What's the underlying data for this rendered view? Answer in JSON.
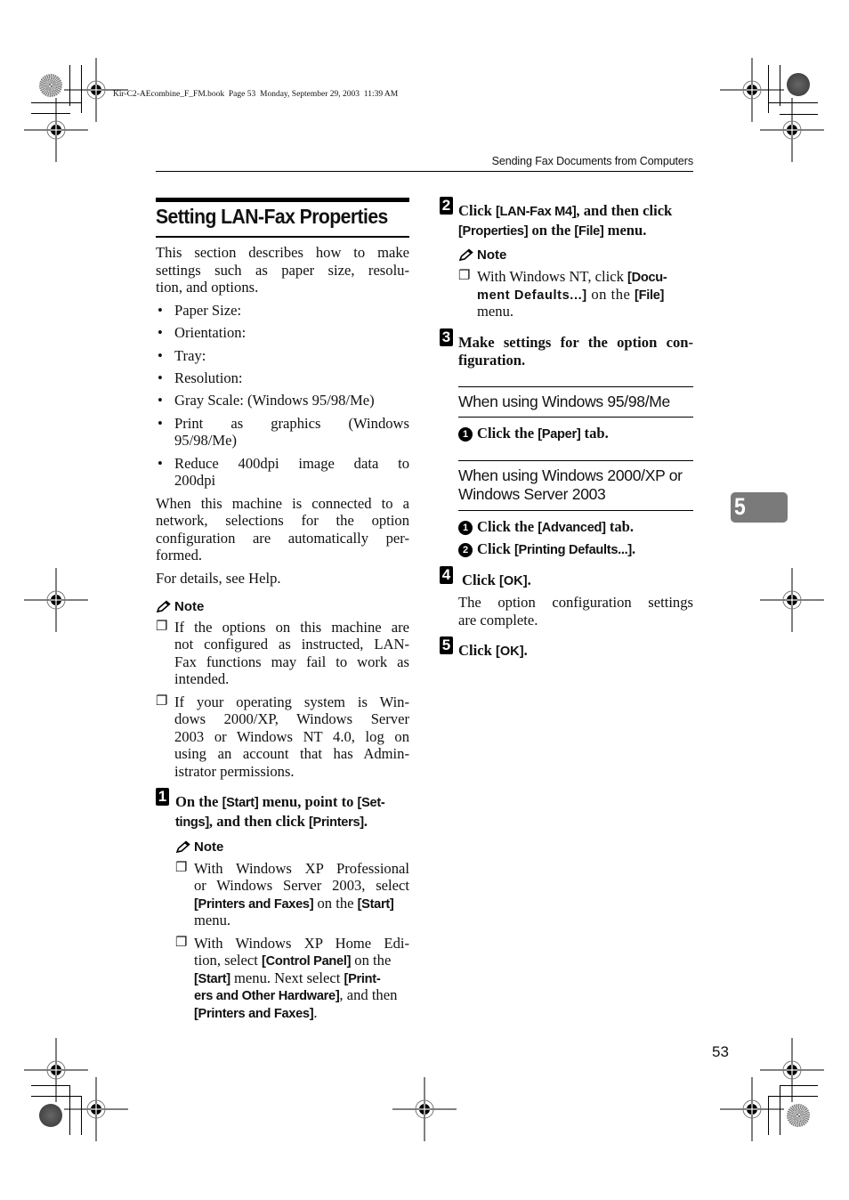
{
  "slug_line": "Kir-C2-AEcombine_F_FM.book  Page 53  Monday, September 29, 2003  11:39 AM",
  "running_head": "Sending Fax Documents from Computers",
  "chapter_tab": "5",
  "page_number": "53",
  "section": {
    "title": "Setting LAN-Fax Properties",
    "intro": "This section describes how to make settings such as paper size, resolution, and options.",
    "intro_lines": [
      "This section describes how to make",
      "settings such as paper size, resolu-",
      "tion, and options."
    ],
    "bullets": [
      {
        "lines": [
          "Paper Size:"
        ]
      },
      {
        "lines": [
          "Orientation:"
        ]
      },
      {
        "lines": [
          "Tray:"
        ]
      },
      {
        "lines": [
          "Resolution:"
        ]
      },
      {
        "lines": [
          "Gray Scale: (Windows 95/98/Me)"
        ]
      },
      {
        "lines": [
          "Print as graphics (Windows",
          "95/98/Me)"
        ]
      },
      {
        "lines": [
          "Reduce 400dpi image data to",
          "200dpi"
        ]
      }
    ],
    "network_para_lines": [
      "When this machine is connected to a",
      "network, selections for the option",
      "configuration are automatically per-",
      "formed."
    ],
    "help_para": "For details, see Help.",
    "note": {
      "label": "Note",
      "items": [
        {
          "lines": [
            "If the options on this machine are",
            "not configured as instructed, LAN-",
            "Fax functions may fail to work as",
            "intended."
          ]
        },
        {
          "lines": [
            "If your operating system is Win-",
            "dows 2000/XP, Windows Server",
            "2003 or Windows NT 4.0, log on",
            "using an account that has Admin-",
            "istrator permissions."
          ]
        }
      ]
    }
  },
  "steps": [
    {
      "number": "1",
      "line1_a": "On the ",
      "line1_ui1": "[Start]",
      "line1_b": " menu, point to ",
      "line1_ui2": "[Set-",
      "line2_ui": "tings]",
      "line2_b": ", and then click ",
      "line2_ui2": "[Printers]",
      "line2_c": ".",
      "note": {
        "label": "Note",
        "item1": {
          "l1": "With Windows XP Professional",
          "l2": "or Windows Server 2003, select",
          "l3_ui1": "[Printers and Faxes]",
          "l3_b": " on the ",
          "l3_ui2": "[Start]",
          "l4": "menu."
        },
        "item2": {
          "l1": "With Windows XP Home Edi-",
          "l2_a": "tion, select ",
          "l2_ui": "[Control Panel]",
          "l2_b": " on the",
          "l3_ui1": "[Start]",
          "l3_b": " menu. Next select ",
          "l3_ui2": "[Print-",
          "l4_ui": "ers and Other Hardware]",
          "l4_b": ", and then",
          "l5_ui": "[Printers and Faxes]",
          "l5_b": "."
        }
      }
    },
    {
      "number": "2",
      "line1_a": "Click ",
      "line1_ui": "[LAN-Fax M4]",
      "line1_b": ", and then click",
      "line2_ui1": "[Properties]",
      "line2_b": " on the ",
      "line2_ui2": "[File]",
      "line2_c": " menu.",
      "note": {
        "label": "Note",
        "l1_a": "With Windows NT, click ",
        "l1_ui": "[Docu-",
        "l2_ui": "ment Defaults...]",
        "l2_b": " on the ",
        "l2_ui2": "[File]",
        "l3": "menu."
      }
    },
    {
      "number": "3",
      "lines": [
        "Make settings for the option con-",
        "figuration."
      ],
      "subsections": [
        {
          "title_lines": [
            "When using Windows 95/98/Me"
          ],
          "substeps": [
            {
              "num": "1",
              "a": "Click the ",
              "ui": "[Paper]",
              "b": " tab."
            }
          ]
        },
        {
          "title_lines": [
            "When using Windows 2000/XP or",
            "Windows Server 2003"
          ],
          "substeps": [
            {
              "num": "1",
              "a": "Click the ",
              "ui": "[Advanced]",
              "b": " tab."
            },
            {
              "num": "2",
              "a": "Click ",
              "ui": "[Printing Defaults...]",
              "b": "."
            }
          ]
        }
      ]
    },
    {
      "number": "4",
      "a": "Click ",
      "ui": "[OK]",
      "b": ".",
      "desc_lines": [
        "The option configuration settings",
        "are complete."
      ]
    },
    {
      "number": "5",
      "a": "Click ",
      "ui": "[OK]",
      "b": "."
    }
  ]
}
